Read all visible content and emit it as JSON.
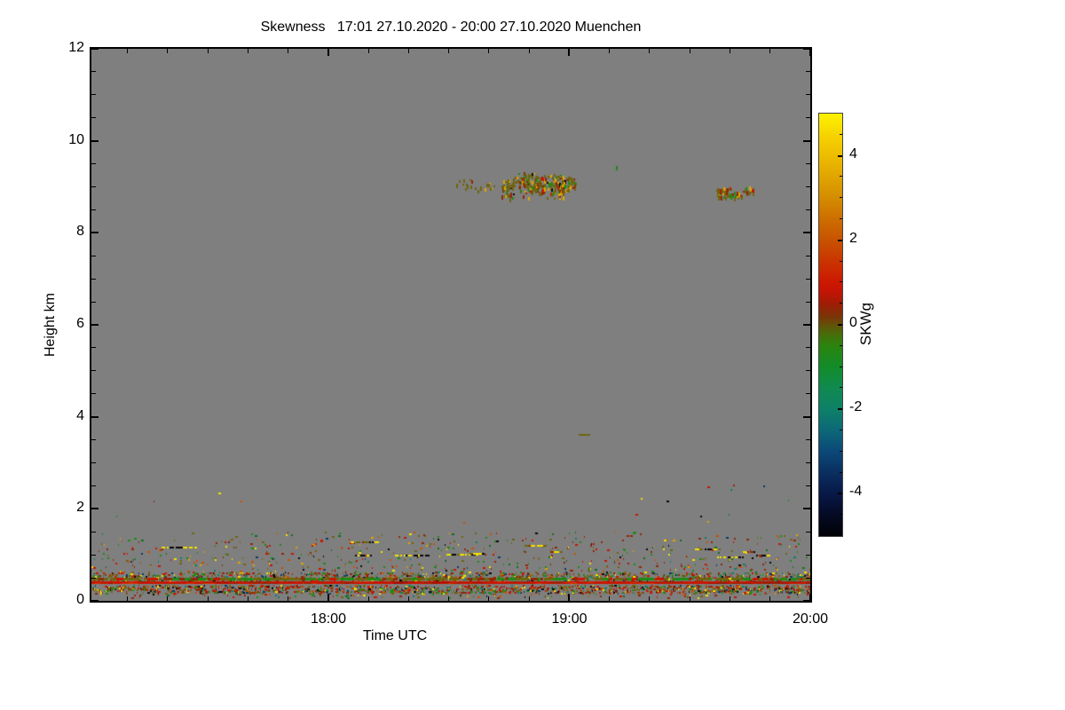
{
  "chart_data": {
    "type": "heatmap",
    "title": "Skewness   17:01 27.10.2020 - 20:00 27.10.2020 Muenchen",
    "xlabel": "Time UTC",
    "ylabel": "Height km",
    "station": "Muenchen",
    "time_start": "17:01 27.10.2020",
    "time_end": "20:00 27.10.2020",
    "x_total_minutes": 179,
    "x_major_ticks": [
      {
        "label": "18:00",
        "minutes": 59
      },
      {
        "label": "19:00",
        "minutes": 119
      },
      {
        "label": "20:00",
        "minutes": 179
      }
    ],
    "x_minor_tick_minutes": [
      9,
      19,
      29,
      39,
      49,
      69,
      79,
      89,
      99,
      109,
      129,
      139,
      149,
      159,
      169
    ],
    "ylim": [
      0,
      12
    ],
    "y_major_ticks": [
      {
        "label": "0",
        "km": 0
      },
      {
        "label": "2",
        "km": 2
      },
      {
        "label": "4",
        "km": 4
      },
      {
        "label": "6",
        "km": 6
      },
      {
        "label": "8",
        "km": 8
      },
      {
        "label": "10",
        "km": 10
      },
      {
        "label": "12",
        "km": 12
      }
    ],
    "y_minor_step_km": 0.5,
    "no_data_color": "#7f7f7f",
    "grid": false,
    "colorbar": {
      "label": "SKWg",
      "min": -5,
      "max": 5,
      "tick_labels": [
        {
          "label": "4",
          "value": 4
        },
        {
          "label": "2",
          "value": 2
        },
        {
          "label": "0",
          "value": 0
        },
        {
          "label": "-2",
          "value": -2
        },
        {
          "label": "-4",
          "value": -4
        }
      ],
      "minor_tick_step": 0.5,
      "stops": [
        {
          "v": 5,
          "c": "#fdf200"
        },
        {
          "v": 4.5,
          "c": "#f6d400"
        },
        {
          "v": 4,
          "c": "#edbc00"
        },
        {
          "v": 3.5,
          "c": "#e0a400"
        },
        {
          "v": 3,
          "c": "#d48c00"
        },
        {
          "v": 2.5,
          "c": "#cc6e00"
        },
        {
          "v": 2,
          "c": "#c85200"
        },
        {
          "v": 1.5,
          "c": "#ca3400"
        },
        {
          "v": 1,
          "c": "#cc1800"
        },
        {
          "v": 0.8,
          "c": "#c41405"
        },
        {
          "v": 0.5,
          "c": "#a01c05"
        },
        {
          "v": 0.2,
          "c": "#7a3408"
        },
        {
          "v": 0,
          "c": "#635108"
        },
        {
          "v": -0.2,
          "c": "#4a6a0a"
        },
        {
          "v": -0.5,
          "c": "#2a840e"
        },
        {
          "v": -1,
          "c": "#128c2a"
        },
        {
          "v": -1.5,
          "c": "#108a50"
        },
        {
          "v": -2,
          "c": "#0e8068"
        },
        {
          "v": -2.5,
          "c": "#0c6878"
        },
        {
          "v": -3,
          "c": "#0b4878"
        },
        {
          "v": -3.5,
          "c": "#0a2f60"
        },
        {
          "v": -4,
          "c": "#081847"
        },
        {
          "v": -4.5,
          "c": "#040a24"
        },
        {
          "v": -5,
          "c": "#020206"
        }
      ]
    },
    "default_palette": {
      "#6f6410": 0.16,
      "#8f2808": 0.16,
      "#c81600": 0.13,
      "#c85200": 0.08,
      "#e0a400": 0.06,
      "#f2e000": 0.08,
      "#1e8a14": 0.14,
      "#0f6e20": 0.05,
      "#0e8068": 0.05,
      "#0b3a66": 0.04,
      "#08080c": 0.05
    },
    "features": [
      {
        "kind": "clumps",
        "name": "cirrus-cloud-sparse-left",
        "time_min": [
          91,
          106
        ],
        "height_km": [
          8.92,
          9.12
        ],
        "clumps": 16,
        "specks_min": 1,
        "specks_max": 4,
        "spread_x": 5,
        "spread_y": 4,
        "palette": {
          "#6f6410": 0.6,
          "#8f2808": 0.15,
          "#1e8a14": 0.1,
          "#e0a400": 0.1,
          "#08080c": 0.05
        }
      },
      {
        "kind": "clumps",
        "name": "cirrus-cloud-dense",
        "time_min": [
          103,
          119.5
        ],
        "height_km": [
          8.85,
          9.2
        ],
        "clumps": 30,
        "specks_min": 4,
        "specks_max": 14,
        "spread_x": 7,
        "spread_y": 7,
        "palette": {
          "#6f6410": 0.5,
          "#8f2808": 0.2,
          "#1e8a14": 0.12,
          "#e0a400": 0.12,
          "#c81600": 0.03,
          "#08080c": 0.03
        }
      },
      {
        "kind": "clumps",
        "name": "cirrus-cloud-patch-right",
        "time_min": [
          156.5,
          164.5
        ],
        "height_km": [
          8.8,
          8.95
        ],
        "clumps": 14,
        "specks_min": 3,
        "specks_max": 8,
        "spread_x": 5,
        "spread_y": 3,
        "palette": {
          "#6f6410": 0.5,
          "#8f2808": 0.22,
          "#e0a400": 0.15,
          "#1e8a14": 0.08,
          "#c81600": 0.05
        }
      },
      {
        "kind": "dash",
        "name": "isolated-dash-3km6",
        "time_min": 121.5,
        "height_km": 3.62,
        "w": 13,
        "h": 2,
        "color": "#6f6410"
      },
      {
        "kind": "dash",
        "name": "isolated-speck-9km4",
        "time_min": 130.8,
        "height_km": 9.45,
        "w": 2,
        "h": 5,
        "color": "#1e8a14"
      },
      {
        "kind": "speckle",
        "name": "free-troposphere-isolated-specks",
        "time_min": [
          0,
          179
        ],
        "height_km": [
          1.5,
          2.75
        ],
        "count": 16
      },
      {
        "kind": "speckle",
        "name": "mixed-layer-upper-specks",
        "time_min": [
          0,
          179
        ],
        "height_km": [
          0.95,
          1.5
        ],
        "count": 270
      },
      {
        "kind": "dashruns",
        "name": "aerosol-layer-dash-runs",
        "time_min": [
          0,
          179
        ],
        "height_km": [
          0.95,
          1.3
        ],
        "runs": 12,
        "palette": {
          "#f2e000": 0.45,
          "#08080c": 0.3,
          "#6f6410": 0.15,
          "#8f2808": 0.1
        }
      },
      {
        "kind": "speckle",
        "name": "mixed-layer-lower-specks",
        "time_min": [
          0,
          179
        ],
        "height_km": [
          0.62,
          0.95
        ],
        "count": 260
      },
      {
        "kind": "speckle",
        "name": "near-surface-upper-band",
        "time_min": [
          0,
          179
        ],
        "height_km": [
          0.43,
          0.62
        ],
        "count": 1150,
        "palette": {
          "#6f6410": 0.2,
          "#8f2808": 0.2,
          "#c81600": 0.14,
          "#1e8a14": 0.15,
          "#c85200": 0.07,
          "#f2e000": 0.07,
          "#0e8068": 0.05,
          "#08080c": 0.06,
          "#0b3a66": 0.06
        }
      },
      {
        "kind": "dashline",
        "name": "surface-olive-line",
        "height_km": [
          0.43,
          0.49
        ],
        "coverage": 0.92,
        "palette": {
          "#6f6410": 0.45,
          "#1e8a14": 0.25,
          "#8f2808": 0.18,
          "#c81600": 0.12
        }
      },
      {
        "kind": "hline",
        "name": "surface-red-line",
        "height_km": [
          0.35,
          0.41
        ],
        "color": "#c81600",
        "overlay_colors": [
          "#a01005",
          "#8f2808",
          "#d83000"
        ],
        "overlays": 70
      },
      {
        "kind": "speckle",
        "name": "near-surface-lower-band",
        "time_min": [
          0,
          179
        ],
        "height_km": [
          0.17,
          0.34
        ],
        "count": 1350,
        "palette": {
          "#6f6410": 0.18,
          "#8f2808": 0.2,
          "#c81600": 0.15,
          "#1e8a14": 0.14,
          "#c85200": 0.06,
          "#f2e000": 0.07,
          "#0e8068": 0.05,
          "#08080c": 0.09,
          "#0b3a66": 0.06
        }
      },
      {
        "kind": "speckle",
        "name": "lowest-gate-sparse",
        "time_min": [
          0,
          179
        ],
        "height_km": [
          0.06,
          0.17
        ],
        "count": 110
      }
    ]
  }
}
